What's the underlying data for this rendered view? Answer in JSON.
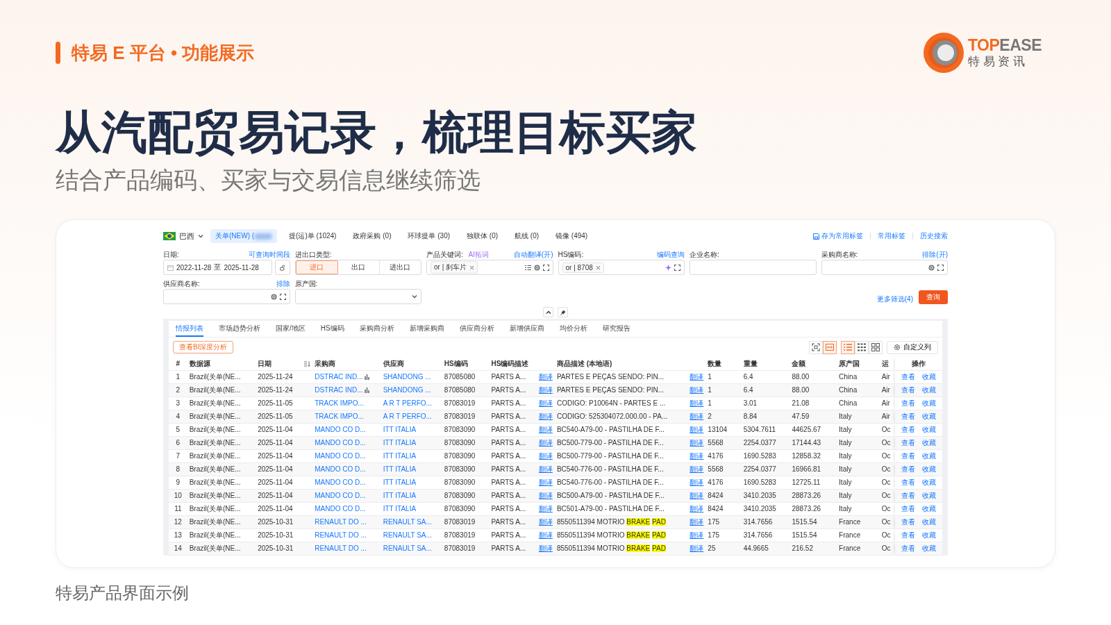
{
  "header": {
    "title": "特易 E 平台 • 功能展示"
  },
  "logo": {
    "brand_part_1": "TOP",
    "brand_part_2": "EASE",
    "tagline": "特 易 资 讯"
  },
  "headline": "从汽配贸易记录，梳理目标买家",
  "subheadline": "结合产品编码、买家与交易信息继续筛选",
  "app": {
    "country": {
      "name": "巴西"
    },
    "source_tabs": [
      {
        "label": "关单(NEW) (",
        "selected": true,
        "count_hidden": true
      },
      {
        "label": "提(运)单 (1024)",
        "selected": false,
        "count_hidden": false
      },
      {
        "label": "政府采购 (0)",
        "selected": false,
        "count_hidden": false
      },
      {
        "label": "环球提单 (30)",
        "selected": false,
        "count_hidden": false
      },
      {
        "label": "独联体 (0)",
        "selected": false,
        "count_hidden": false
      },
      {
        "label": "航线 (0)",
        "selected": false,
        "count_hidden": false
      },
      {
        "label": "镜像 (494)",
        "selected": false,
        "count_hidden": false
      }
    ],
    "top_links": [
      "存为常用标签",
      "常用标签",
      "历史搜索"
    ],
    "date": {
      "label": "日期:",
      "link": "可查询时间段",
      "start": "2022-11-28",
      "separator": "至",
      "end": "2025-11-28"
    },
    "trade_type": {
      "label": "进出口类型:",
      "options": [
        {
          "label": "进口",
          "selected": true
        },
        {
          "label": "出口",
          "selected": false
        },
        {
          "label": "进出口",
          "selected": false
        }
      ]
    },
    "keyword": {
      "label": "产品关键词:",
      "ai_link": "AI拓词",
      "link": "自动翻译(开)",
      "tags": [
        "or | 刹车片"
      ]
    },
    "hs_code": {
      "label": "HS编码:",
      "link": "编码查询",
      "tags": [
        "or | 8708"
      ]
    },
    "company": {
      "label": "企业名称:"
    },
    "buyer": {
      "label": "采购商名称:",
      "link": "排除(开)"
    },
    "supplier": {
      "label": "供应商名称:",
      "link": "排除"
    },
    "origin": {
      "label": "原产国:"
    },
    "more_filters": "更多筛选(4)",
    "search_button": "查询",
    "result_tabs": [
      {
        "label": "情报列表",
        "selected": true
      },
      {
        "label": "市场趋势分析",
        "selected": false
      },
      {
        "label": "国家/地区",
        "selected": false
      },
      {
        "label": "HS编码",
        "selected": false
      },
      {
        "label": "采购商分析",
        "selected": false
      },
      {
        "label": "新增采购商",
        "selected": false
      },
      {
        "label": "供应商分析",
        "selected": false
      },
      {
        "label": "新增供应商",
        "selected": false
      },
      {
        "label": "均价分析",
        "selected": false
      },
      {
        "label": "研究报告",
        "selected": false
      }
    ],
    "bi_button": "查看BI深度分析",
    "view_toggles": [
      {
        "kind": "fullscreen",
        "selected": false
      },
      {
        "kind": "fit",
        "selected": true
      }
    ],
    "layout_toggles": [
      {
        "kind": "list",
        "selected": true
      },
      {
        "kind": "grid",
        "selected": false
      },
      {
        "kind": "cards",
        "selected": false
      }
    ],
    "columns_button": "自定义列",
    "table": {
      "columns": [
        {
          "label": "#",
          "sortable": false
        },
        {
          "label": "数据源",
          "sortable": false
        },
        {
          "label": "日期",
          "sortable": true
        },
        {
          "label": "采购商",
          "sortable": false
        },
        {
          "label": "供应商",
          "sortable": false
        },
        {
          "label": "HS编码",
          "sortable": false
        },
        {
          "label": "HS编码描述",
          "sortable": false
        },
        {
          "label": "商品描述 (本地语)",
          "sortable": false
        },
        {
          "label": "数量",
          "sortable": false
        },
        {
          "label": "重量",
          "sortable": false
        },
        {
          "label": "金额",
          "sortable": false
        },
        {
          "label": "原产国",
          "sortable": false
        },
        {
          "label": "运",
          "sortable": false
        },
        {
          "label": "操作",
          "sortable": false
        }
      ],
      "rows": [
        {
          "no": "1",
          "source": "Brazil(关单(NE...",
          "date": "2025-11-24",
          "buyer": "DSTRAC IND...",
          "buyer_icon": true,
          "supplier": "SHANDONG ...",
          "hs": "87085080",
          "hs_desc": "PARTS A...",
          "hs_desc_translate": "翻译",
          "desc": [
            {
              "text": "PARTES E PEÇAS SENDO: PIN...",
              "highlight": false
            }
          ],
          "desc_translate": "翻译",
          "qty": "1",
          "weight": "6.4",
          "amount": "88.00",
          "origin": "China",
          "transport": "Air",
          "actions": [
            "查看",
            "收藏"
          ]
        },
        {
          "no": "2",
          "source": "Brazil(关单(NE...",
          "date": "2025-11-24",
          "buyer": "DSTRAC IND...",
          "buyer_icon": true,
          "supplier": "SHANDONG ...",
          "hs": "87085080",
          "hs_desc": "PARTS A...",
          "hs_desc_translate": "翻译",
          "desc": [
            {
              "text": "PARTES E PEÇAS SENDO: PIN...",
              "highlight": false
            }
          ],
          "desc_translate": "翻译",
          "qty": "1",
          "weight": "6.4",
          "amount": "88.00",
          "origin": "China",
          "transport": "Air",
          "actions": [
            "查看",
            "收藏"
          ]
        },
        {
          "no": "3",
          "source": "Brazil(关单(NE...",
          "date": "2025-11-05",
          "buyer": "TRACK IMPO...",
          "buyer_icon": false,
          "supplier": "A R T PERFO...",
          "hs": "87083019",
          "hs_desc": "PARTS A...",
          "hs_desc_translate": "翻译",
          "desc": [
            {
              "text": "CODIGO: P10064N - PARTES E ...",
              "highlight": false
            }
          ],
          "desc_translate": "翻译",
          "qty": "1",
          "weight": "3.01",
          "amount": "21.08",
          "origin": "China",
          "transport": "Air",
          "actions": [
            "查看",
            "收藏"
          ]
        },
        {
          "no": "4",
          "source": "Brazil(关单(NE...",
          "date": "2025-11-05",
          "buyer": "TRACK IMPO...",
          "buyer_icon": false,
          "supplier": "A R T PERFO...",
          "hs": "87083019",
          "hs_desc": "PARTS A...",
          "hs_desc_translate": "翻译",
          "desc": [
            {
              "text": "CODIGO: 525304072.000.00 - PA...",
              "highlight": false
            }
          ],
          "desc_translate": "翻译",
          "qty": "2",
          "weight": "8.84",
          "amount": "47.59",
          "origin": "Italy",
          "transport": "Air",
          "actions": [
            "查看",
            "收藏"
          ]
        },
        {
          "no": "5",
          "source": "Brazil(关单(NE...",
          "date": "2025-11-04",
          "buyer": "MANDO CO D...",
          "buyer_icon": false,
          "supplier": "ITT ITALIA",
          "hs": "87083090",
          "hs_desc": "PARTS A...",
          "hs_desc_translate": "翻译",
          "desc": [
            {
              "text": "BC540-A79-00 - PASTILHA DE F...",
              "highlight": false
            }
          ],
          "desc_translate": "翻译",
          "qty": "13104",
          "weight": "5304.7611",
          "amount": "44625.67",
          "origin": "Italy",
          "transport": "Oc",
          "actions": [
            "查看",
            "收藏"
          ]
        },
        {
          "no": "6",
          "source": "Brazil(关单(NE...",
          "date": "2025-11-04",
          "buyer": "MANDO CO D...",
          "buyer_icon": false,
          "supplier": "ITT ITALIA",
          "hs": "87083090",
          "hs_desc": "PARTS A...",
          "hs_desc_translate": "翻译",
          "desc": [
            {
              "text": "BC500-779-00 - PASTILHA DE F...",
              "highlight": false
            }
          ],
          "desc_translate": "翻译",
          "qty": "5568",
          "weight": "2254.0377",
          "amount": "17144.43",
          "origin": "Italy",
          "transport": "Oc",
          "actions": [
            "查看",
            "收藏"
          ]
        },
        {
          "no": "7",
          "source": "Brazil(关单(NE...",
          "date": "2025-11-04",
          "buyer": "MANDO CO D...",
          "buyer_icon": false,
          "supplier": "ITT ITALIA",
          "hs": "87083090",
          "hs_desc": "PARTS A...",
          "hs_desc_translate": "翻译",
          "desc": [
            {
              "text": "BC500-779-00 - PASTILHA DE F...",
              "highlight": false
            }
          ],
          "desc_translate": "翻译",
          "qty": "4176",
          "weight": "1690.5283",
          "amount": "12858.32",
          "origin": "Italy",
          "transport": "Oc",
          "actions": [
            "查看",
            "收藏"
          ]
        },
        {
          "no": "8",
          "source": "Brazil(关单(NE...",
          "date": "2025-11-04",
          "buyer": "MANDO CO D...",
          "buyer_icon": false,
          "supplier": "ITT ITALIA",
          "hs": "87083090",
          "hs_desc": "PARTS A...",
          "hs_desc_translate": "翻译",
          "desc": [
            {
              "text": "BC540-776-00 - PASTILHA DE F...",
              "highlight": false
            }
          ],
          "desc_translate": "翻译",
          "qty": "5568",
          "weight": "2254.0377",
          "amount": "16966.81",
          "origin": "Italy",
          "transport": "Oc",
          "actions": [
            "查看",
            "收藏"
          ]
        },
        {
          "no": "9",
          "source": "Brazil(关单(NE...",
          "date": "2025-11-04",
          "buyer": "MANDO CO D...",
          "buyer_icon": false,
          "supplier": "ITT ITALIA",
          "hs": "87083090",
          "hs_desc": "PARTS A...",
          "hs_desc_translate": "翻译",
          "desc": [
            {
              "text": "BC540-776-00 - PASTILHA DE F...",
              "highlight": false
            }
          ],
          "desc_translate": "翻译",
          "qty": "4176",
          "weight": "1690.5283",
          "amount": "12725.11",
          "origin": "Italy",
          "transport": "Oc",
          "actions": [
            "查看",
            "收藏"
          ]
        },
        {
          "no": "10",
          "source": "Brazil(关单(NE...",
          "date": "2025-11-04",
          "buyer": "MANDO CO D...",
          "buyer_icon": false,
          "supplier": "ITT ITALIA",
          "hs": "87083090",
          "hs_desc": "PARTS A...",
          "hs_desc_translate": "翻译",
          "desc": [
            {
              "text": "BC500-A79-00 - PASTILHA DE F...",
              "highlight": false
            }
          ],
          "desc_translate": "翻译",
          "qty": "8424",
          "weight": "3410.2035",
          "amount": "28873.26",
          "origin": "Italy",
          "transport": "Oc",
          "actions": [
            "查看",
            "收藏"
          ]
        },
        {
          "no": "11",
          "source": "Brazil(关单(NE...",
          "date": "2025-11-04",
          "buyer": "MANDO CO D...",
          "buyer_icon": false,
          "supplier": "ITT ITALIA",
          "hs": "87083090",
          "hs_desc": "PARTS A...",
          "hs_desc_translate": "翻译",
          "desc": [
            {
              "text": "BC501-A79-00 - PASTILHA DE F...",
              "highlight": false
            }
          ],
          "desc_translate": "翻译",
          "qty": "8424",
          "weight": "3410.2035",
          "amount": "28873.26",
          "origin": "Italy",
          "transport": "Oc",
          "actions": [
            "查看",
            "收藏"
          ]
        },
        {
          "no": "12",
          "source": "Brazil(关单(NE...",
          "date": "2025-10-31",
          "buyer": "RENAULT DO ...",
          "buyer_icon": false,
          "supplier": "RENAULT SA...",
          "hs": "87083019",
          "hs_desc": "PARTS A...",
          "hs_desc_translate": "翻译",
          "desc": [
            {
              "text": "8550511394 MOTRIO",
              "highlight": false
            },
            {
              "text": "BRAKE",
              "highlight": true
            },
            {
              "text": "PAD",
              "highlight": true
            }
          ],
          "desc_translate": "翻译",
          "qty": "175",
          "weight": "314.7656",
          "amount": "1515.54",
          "origin": "France",
          "transport": "Oc",
          "actions": [
            "查看",
            "收藏"
          ]
        },
        {
          "no": "13",
          "source": "Brazil(关单(NE...",
          "date": "2025-10-31",
          "buyer": "RENAULT DO ...",
          "buyer_icon": false,
          "supplier": "RENAULT SA...",
          "hs": "87083019",
          "hs_desc": "PARTS A...",
          "hs_desc_translate": "翻译",
          "desc": [
            {
              "text": "8550511394 MOTRIO",
              "highlight": false
            },
            {
              "text": "BRAKE",
              "highlight": true
            },
            {
              "text": "PAD",
              "highlight": true
            }
          ],
          "desc_translate": "翻译",
          "qty": "175",
          "weight": "314.7656",
          "amount": "1515.54",
          "origin": "France",
          "transport": "Oc",
          "actions": [
            "查看",
            "收藏"
          ]
        },
        {
          "no": "14",
          "source": "Brazil(关单(NE...",
          "date": "2025-10-31",
          "buyer": "RENAULT DO ...",
          "buyer_icon": false,
          "supplier": "RENAULT SA...",
          "hs": "87083019",
          "hs_desc": "PARTS A...",
          "hs_desc_translate": "翻译",
          "desc": [
            {
              "text": "8550511394 MOTRIO",
              "highlight": false
            },
            {
              "text": "BRAKE",
              "highlight": true
            },
            {
              "text": "PAD",
              "highlight": true
            }
          ],
          "desc_translate": "翻译",
          "qty": "25",
          "weight": "44.9665",
          "amount": "216.52",
          "origin": "France",
          "transport": "Oc",
          "actions": [
            "查看",
            "收藏"
          ]
        }
      ]
    }
  },
  "caption": "特易产品界面示例"
}
